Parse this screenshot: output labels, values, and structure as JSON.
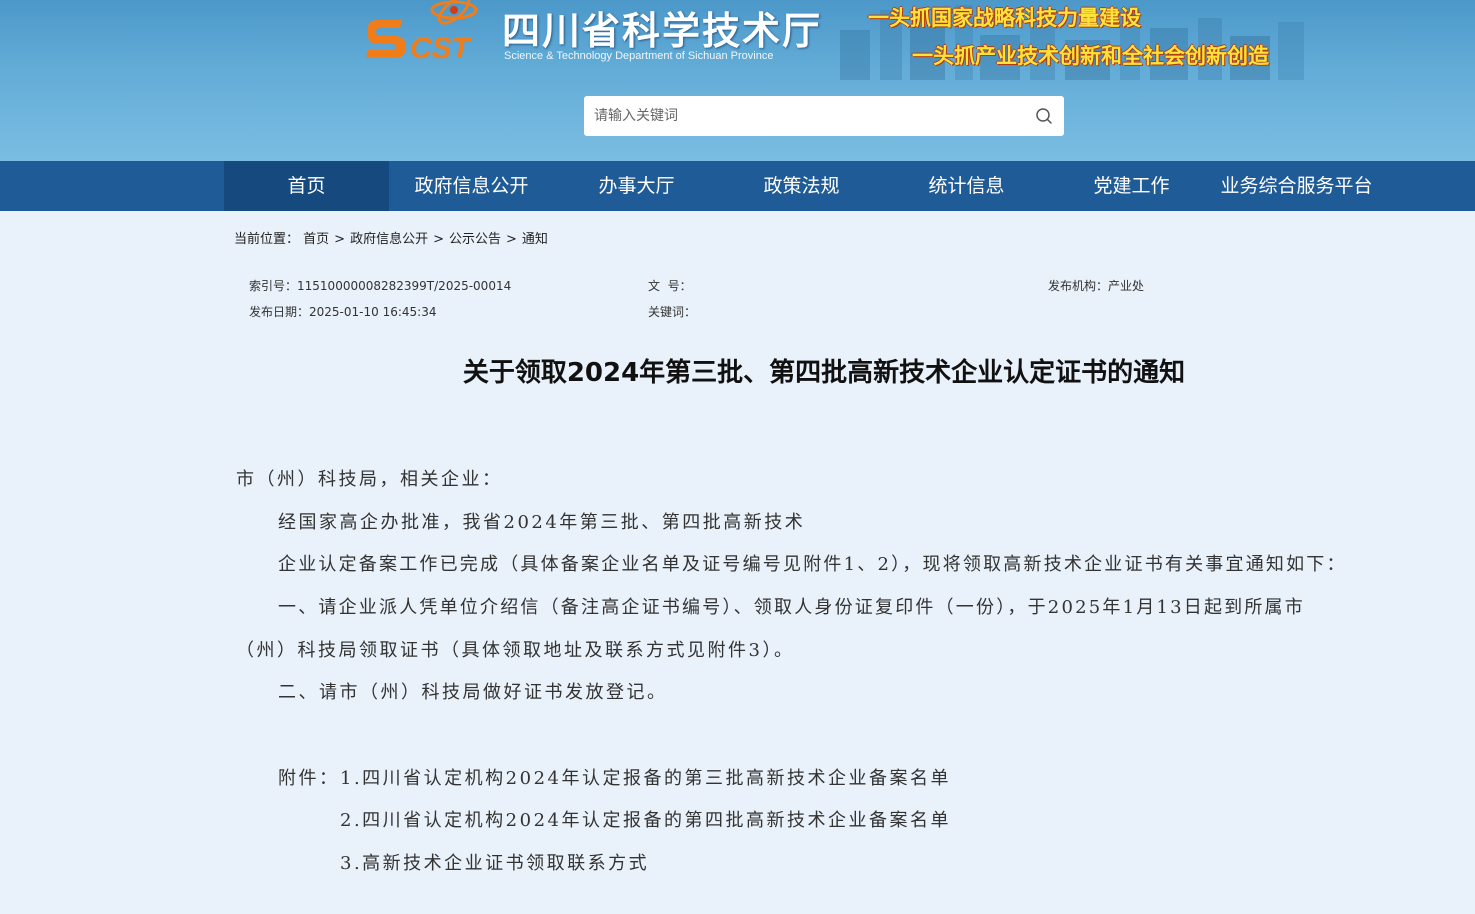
{
  "header": {
    "logo_abbr": "SCST",
    "site_title_cn": "四川省科学技术厅",
    "site_title_en": "Science & Technology Department of Sichuan Province",
    "slogan_1": "一头抓国家战略科技力量建设",
    "slogan_2": "一头抓产业技术创新和全社会创新创造",
    "colors": {
      "logo_orange": "#f07d1a",
      "slogan_yellow": "#ffe23a",
      "nav_bg": "#1f5b96"
    }
  },
  "search": {
    "placeholder": "请输入关键词",
    "value": "",
    "icon": "search-icon"
  },
  "nav": {
    "items": [
      {
        "label": "首页",
        "active": true
      },
      {
        "label": "政府信息公开"
      },
      {
        "label": "办事大厅"
      },
      {
        "label": "政策法规"
      },
      {
        "label": "统计信息"
      },
      {
        "label": "党建工作"
      },
      {
        "label": "业务综合服务平台"
      }
    ]
  },
  "breadcrumb": {
    "label": "当前位置：",
    "items": [
      "首页",
      "政府信息公开",
      "公示公告",
      "通知"
    ],
    "separator": ">"
  },
  "meta": {
    "index_label": "索引号：",
    "index_value": "11510000008282399T/2025-00014",
    "doc_no_label": "文  号：",
    "doc_no_value": "",
    "org_label": "发布机构：",
    "org_value": "产业处",
    "date_label": "发布日期：",
    "date_value": "2025-01-10 16:45:34",
    "keywords_label": "关键词：",
    "keywords_value": ""
  },
  "article": {
    "title": "关于领取2024年第三批、第四批高新技术企业认定证书的通知",
    "salutation": "市（州）科技局，相关企业：",
    "p1_line1": "经国家高企办批准，我省2024年第三批、第四批高新技术",
    "p1_line2": "企业认定备案工作已完成（具体备案企业名单及证号编号见附件1、2），现将领取高新技术企业证书有关事宜通知如下：",
    "p2_line1": "一、请企业派人凭单位介绍信（备注高企证书编号）、领取人身份证复印件（一份），于2025年1月13日起到所属市",
    "p2_line2": "（州）科技局领取证书（具体领取地址及联系方式见附件3）。",
    "p3": "二、请市（州）科技局做好证书发放登记。",
    "attachments_label": "附件：",
    "attachments": [
      "1.四川省认定机构2024年认定报备的第三批高新技术企业备案名单",
      "2.四川省认定机构2024年认定报备的第四批高新技术企业备案名单",
      "3.高新技术企业证书领取联系方式"
    ]
  }
}
